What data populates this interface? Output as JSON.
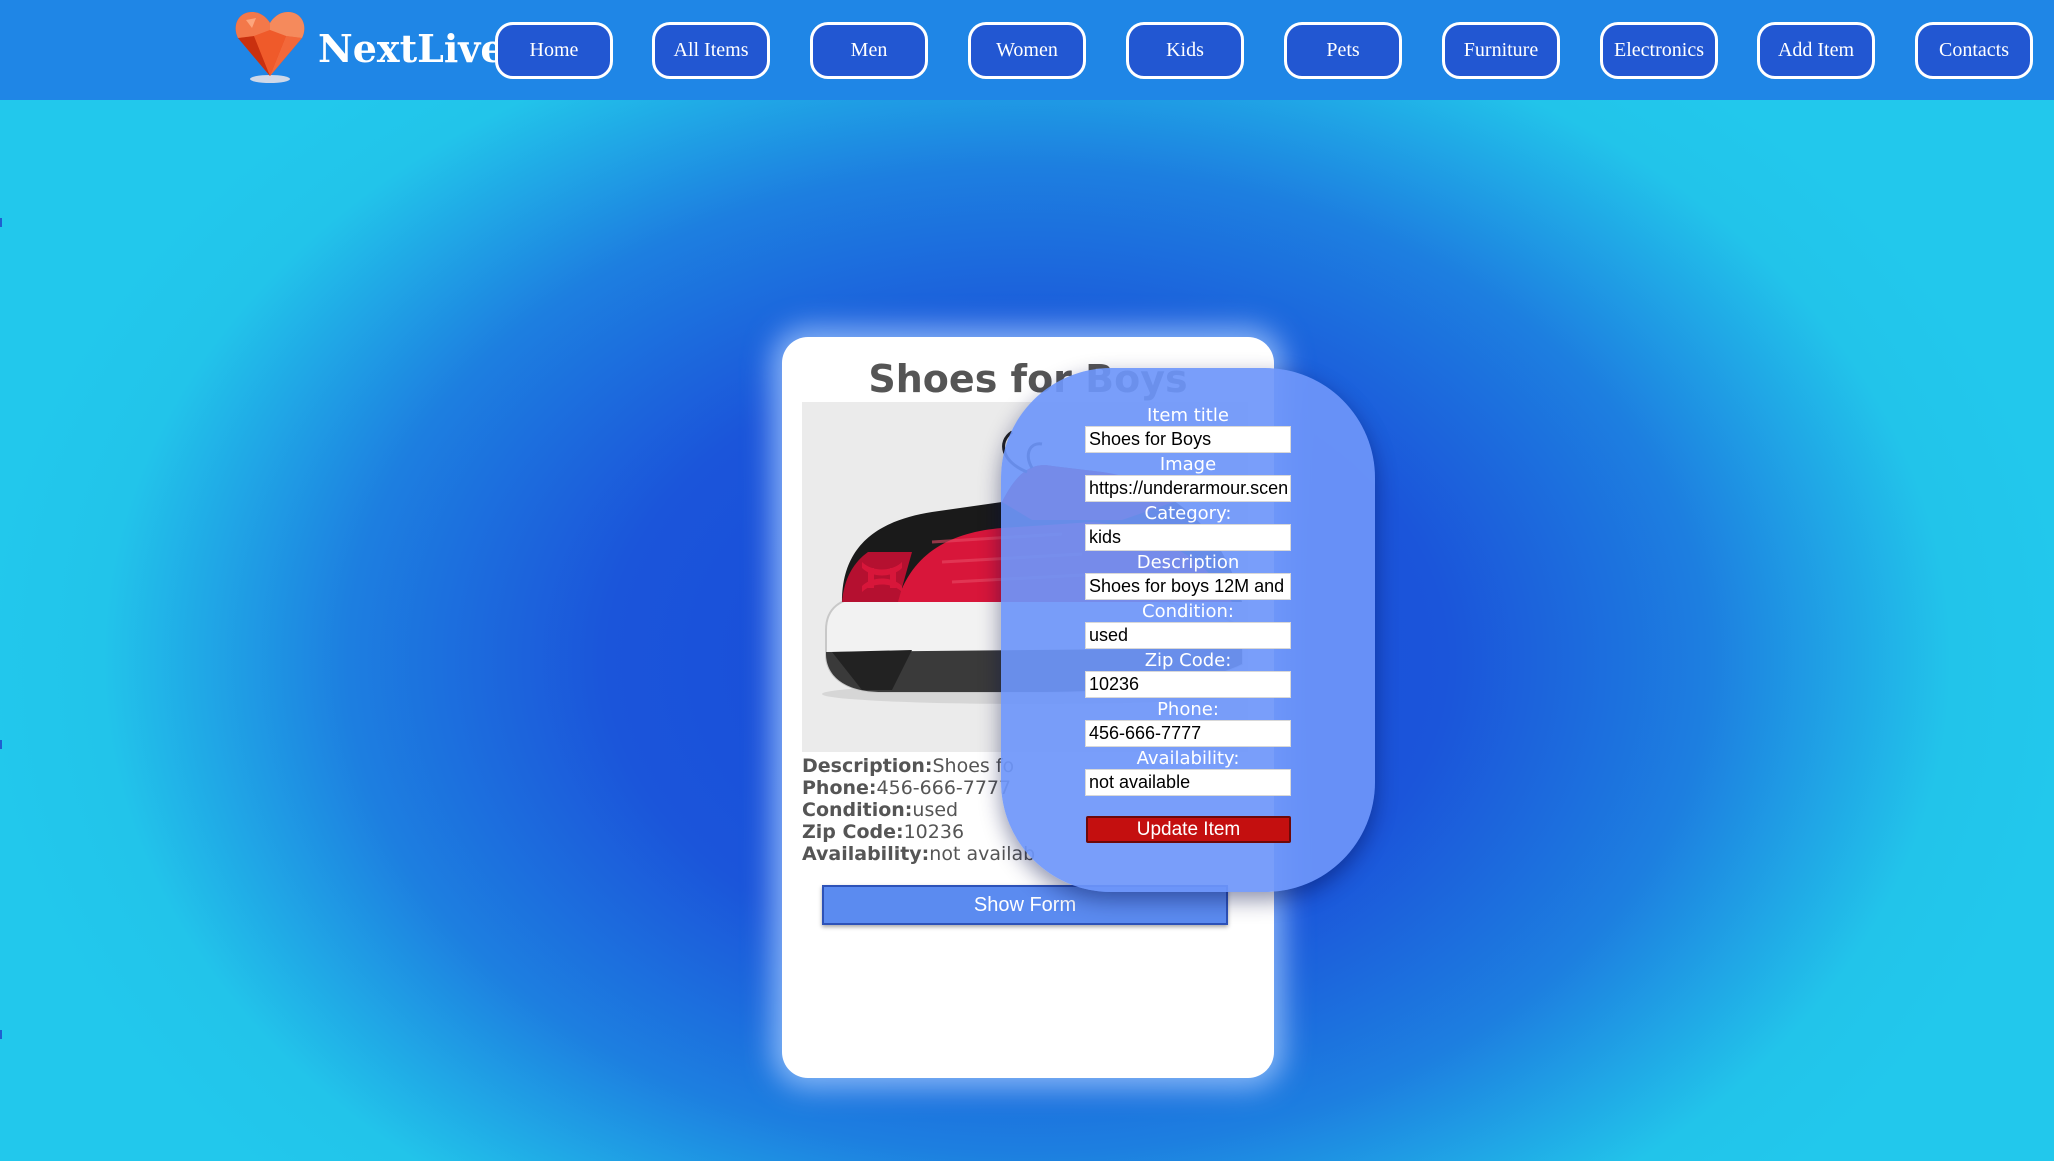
{
  "header": {
    "brand": "NextLive",
    "nav": [
      "Home",
      "All Items",
      "Men",
      "Women",
      "Kids",
      "Pets",
      "Furniture",
      "Electronics",
      "Add Item",
      "Contacts"
    ]
  },
  "item": {
    "title": "Shoes for Boys",
    "details": [
      {
        "label": "Description:",
        "value": "Shoes fo"
      },
      {
        "label": "Phone:",
        "value": "456-666-7777"
      },
      {
        "label": "Condition:",
        "value": "used"
      },
      {
        "label": "Zip Code:",
        "value": "10236"
      },
      {
        "label": "Availability:",
        "value": "not availab"
      }
    ],
    "show_form_label": "Show Form"
  },
  "form": {
    "fields": [
      {
        "label": "Item title",
        "value": "Shoes for Boys"
      },
      {
        "label": "Image",
        "value": "https://underarmour.scen"
      },
      {
        "label": "Category:",
        "value": "kids"
      },
      {
        "label": "Description",
        "value": "Shoes for boys 12M and"
      },
      {
        "label": "Condition:",
        "value": "used"
      },
      {
        "label": "Zip Code:",
        "value": "10236"
      },
      {
        "label": "Phone:",
        "value": "456-666-7777"
      },
      {
        "label": "Availability:",
        "value": "not available"
      }
    ],
    "submit_label": "Update Item"
  },
  "colors": {
    "header": "#1f86e6",
    "nav_button": "#2257d2",
    "form_panel": "#6e96fa",
    "update_button": "#c40f0f",
    "show_form_button": "#5b8bf0"
  }
}
